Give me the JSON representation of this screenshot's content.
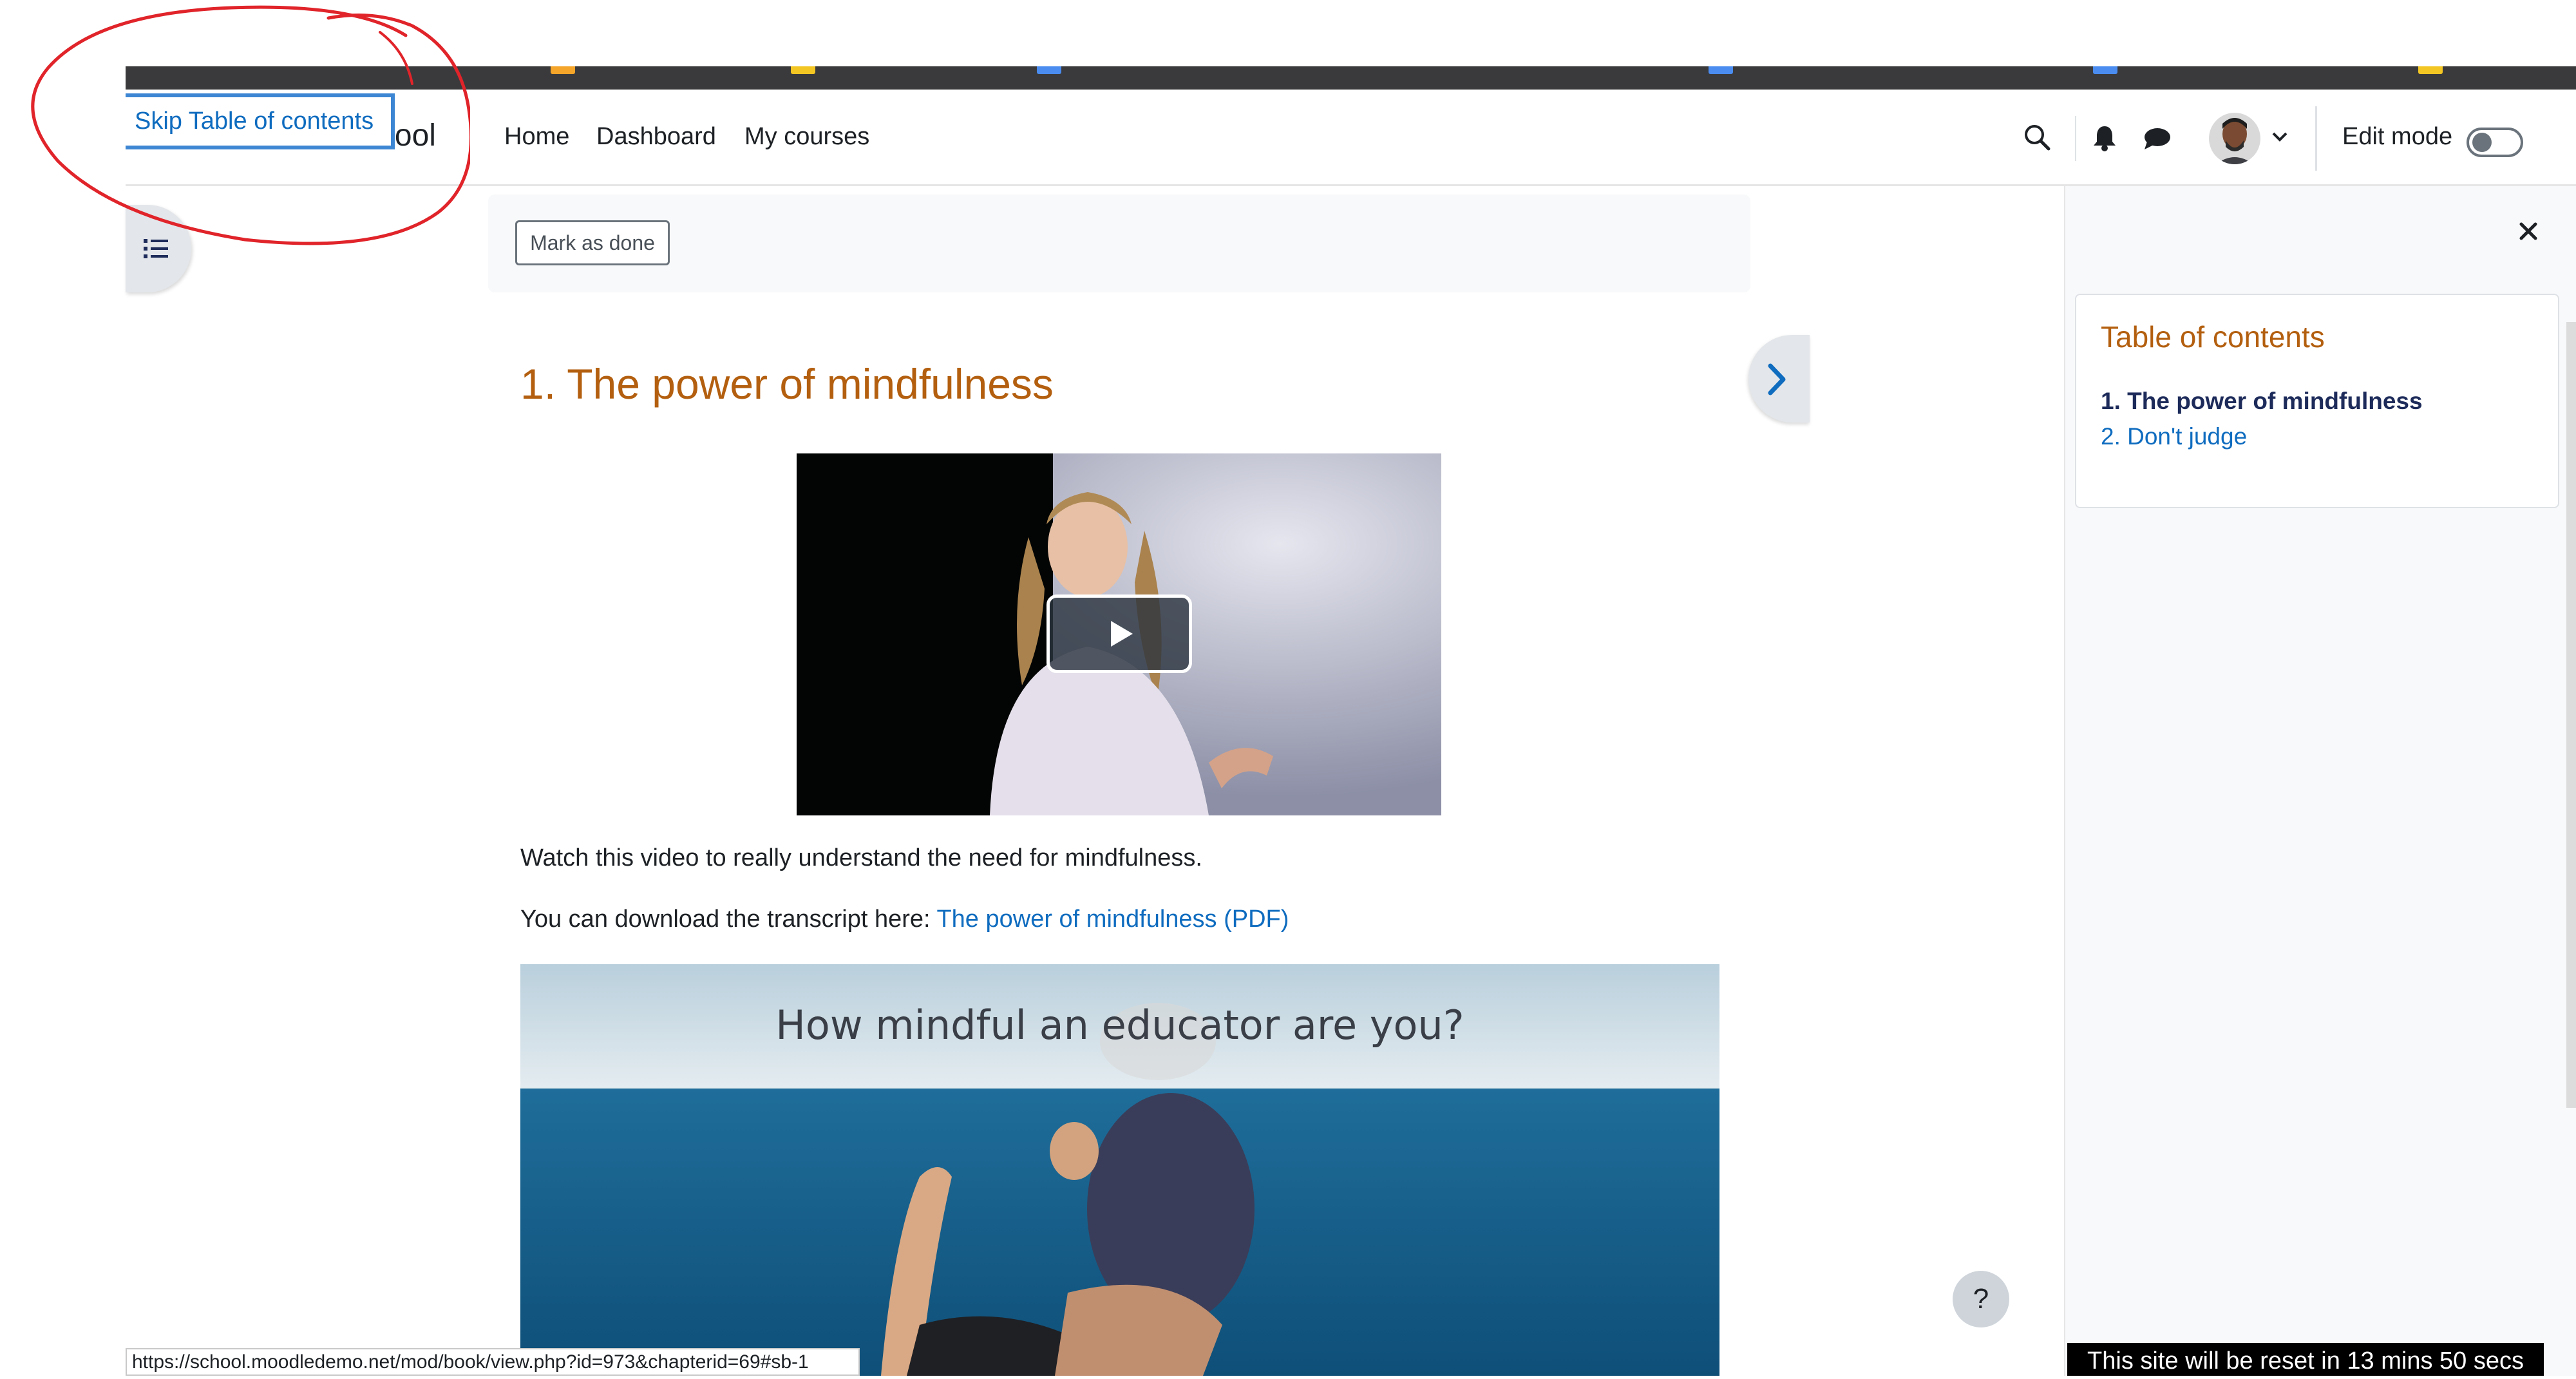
{
  "colors": {
    "brand_orange": "#b35f0f",
    "link_blue": "#0f6cbf",
    "toc_active": "#1d2b5a",
    "annotation_red": "#e0242a",
    "drawer_bg": "#f8f9fa"
  },
  "browser": {
    "status_url": "https://school.moodledemo.net/mod/book/view.php?id=973&chapterid=69#sb-1"
  },
  "skip_link": {
    "label": "Skip Table of contents"
  },
  "navbar": {
    "site_name_fragment": "hool",
    "links": [
      "Home",
      "Dashboard",
      "My courses"
    ],
    "icons": [
      "search-icon",
      "bell-icon",
      "chat-icon",
      "avatar",
      "chevron-down-icon"
    ],
    "edit_mode_label": "Edit mode",
    "edit_mode_on": false
  },
  "completion": {
    "mark_done_label": "Mark as done"
  },
  "chapter": {
    "title": "1. The power of mindfulness",
    "intro_text": "Watch this video to really understand the need for mindfulness.",
    "download_prefix": "You can download the transcript here: ",
    "download_link": "The power of mindfulness (PDF)",
    "banner_title": "How mindful an educator are you?"
  },
  "toc": {
    "title": "Table of contents",
    "items": [
      {
        "label": "1. The power of mindfulness",
        "active": true
      },
      {
        "label": "2. Don't judge",
        "active": false
      }
    ]
  },
  "help": {
    "label": "?"
  },
  "reset_notice": "This site will be reset in 13 mins 50 secs"
}
